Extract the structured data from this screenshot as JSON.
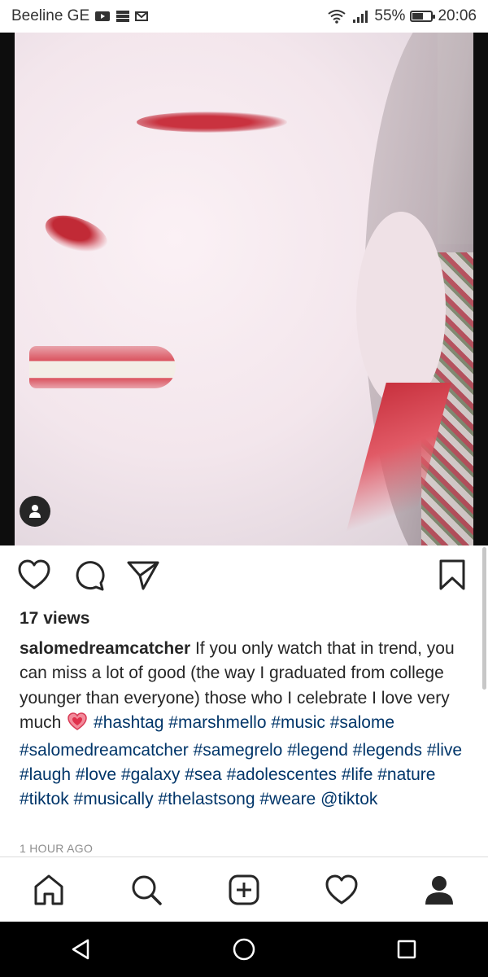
{
  "status": {
    "carrier": "Beeline GE",
    "battery": "55%",
    "time": "20:06",
    "battery_level": 0.55
  },
  "post": {
    "views": "17 views",
    "username": "salomedreamcatcher",
    "caption_text": " If you only watch that in trend, you can miss a lot of good (the way I graduated from college younger than everyone) those who I celebrate I love very much ",
    "hashtags": [
      "#hashtag",
      "#marshmello",
      "#music",
      "#salome",
      "#salomedreamcatcher",
      "#samegrelo",
      "#legend",
      "#legends",
      "#live",
      "#laugh",
      "#love",
      "#galaxy",
      "#sea",
      "#adolescentes",
      "#life",
      "#nature",
      "#tiktok",
      "#musically",
      "#thelastsong",
      "#weare",
      "@tiktok"
    ],
    "timestamp": "1 HOUR AGO"
  },
  "icons": {
    "like": "heart-outline-icon",
    "comment": "comment-bubble-icon",
    "share": "paper-plane-icon",
    "save": "bookmark-icon",
    "tagged": "person-icon"
  },
  "nav": [
    "home-icon",
    "search-icon",
    "add-post-icon",
    "activity-heart-icon",
    "profile-icon"
  ],
  "colors": {
    "hashtag": "#003569",
    "text": "#262626",
    "meta": "#8e8e8e"
  }
}
